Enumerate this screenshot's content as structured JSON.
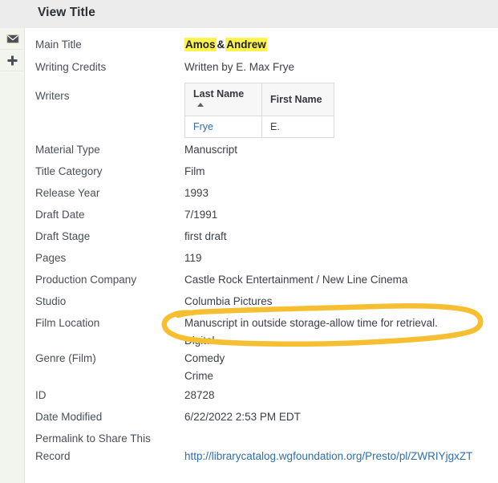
{
  "header": {
    "title": "View Title"
  },
  "sidebar": {
    "items": [
      {
        "icon": "printer-icon",
        "name": "print-action"
      },
      {
        "icon": "envelope-icon",
        "name": "email-action"
      },
      {
        "icon": "plus-icon",
        "name": "add-action"
      }
    ]
  },
  "record": {
    "main_title": {
      "label": "Main Title",
      "part1": "Amos",
      "amp": "&",
      "part2": "Andrew",
      "highlight_color": "#fff34d"
    },
    "fields": [
      {
        "label": "Writing Credits",
        "value": "Written by E. Max Frye"
      },
      {
        "label": "Writers",
        "value": ""
      },
      {
        "label": "Material Type",
        "value": "Manuscript"
      },
      {
        "label": "Title Category",
        "value": "Film"
      },
      {
        "label": "Release Year",
        "value": "1993"
      },
      {
        "label": "Draft Date",
        "value": "7/1991"
      },
      {
        "label": "Draft Stage",
        "value": "first draft"
      },
      {
        "label": "Pages",
        "value": "119"
      },
      {
        "label": "Production Company",
        "value": "Castle Rock Entertainment / New Line Cinema"
      },
      {
        "label": "Studio",
        "value": "Columbia Pictures"
      },
      {
        "label": "Film Location",
        "value": "Manuscript in outside storage-allow time for retrieval."
      },
      {
        "label": "",
        "value": "Digital"
      },
      {
        "label": "Genre (Film)",
        "value": "Comedy"
      },
      {
        "label": "",
        "value": "Crime"
      },
      {
        "label": "ID",
        "value": "28728"
      },
      {
        "label": "Date Modified",
        "value": "6/22/2022 2:53 PM EDT"
      }
    ],
    "permalink": {
      "label_line1": "Permalink to Share This",
      "label_line2": "Record",
      "url": "http://librarycatalog.wgfoundation.org/Presto/pl/ZWRIYjgxZT"
    }
  },
  "writers_table": {
    "columns": [
      {
        "label": "Last Name",
        "sorted": "asc"
      },
      {
        "label": "First Name",
        "sorted": ""
      }
    ],
    "rows": [
      {
        "last_name": "Frye",
        "first_name": "E."
      }
    ]
  },
  "annotation": {
    "type": "hand-drawn-ellipse",
    "color": "#f5bf31",
    "target": "Film Location"
  }
}
